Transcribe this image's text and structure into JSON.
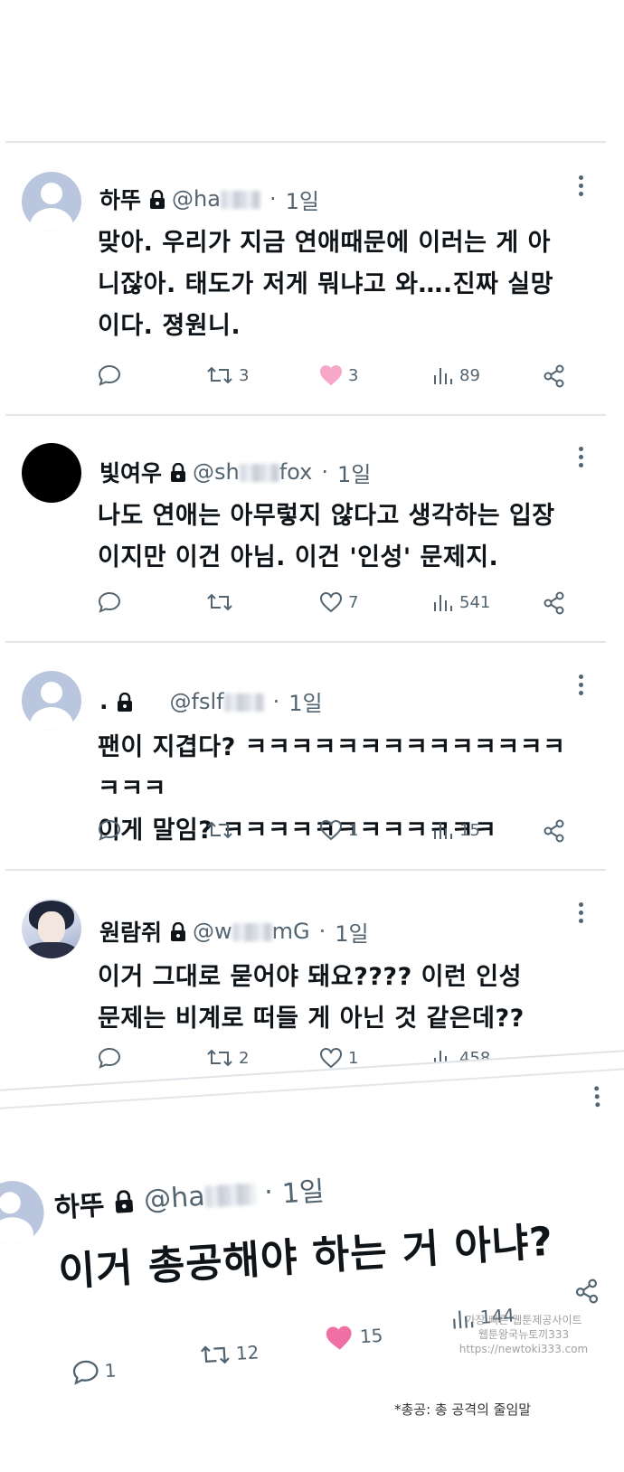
{
  "colors": {
    "like_active": "#f91880",
    "muted": "#536471",
    "divider": "#e4e6e8",
    "avatar_default": "#b9c6dd"
  },
  "tweets": [
    {
      "name": "하뚜",
      "locked": true,
      "handle_start": "@ha",
      "handle_end": "",
      "time": "1일",
      "lines": [
        "맞아. 우리가 지금 연애때문에 이러는 게 아",
        "니잖아. 태도가 저게 뭐냐고 와….진짜 실망",
        "이다. 졍원니."
      ],
      "replies": "",
      "retweets": "3",
      "likes": "3",
      "liked": true,
      "views": "89",
      "avatar": "default"
    },
    {
      "name": "빛여우",
      "locked": true,
      "handle_start": "@sh",
      "handle_end": "fox",
      "time": "1일",
      "lines": [
        "나도 연애는 아무렇지 않다고 생각하는 입장",
        "이지만 이건 아님. 이건 '인성' 문제지."
      ],
      "replies": "",
      "retweets": "",
      "likes": "7",
      "liked": false,
      "views": "541",
      "avatar": "black"
    },
    {
      "name": ".",
      "locked": true,
      "handle_start": "@fslf",
      "handle_end": "",
      "time": "1일",
      "lines": [
        "팬이 지겹다? ㅋㅋㅋㅋㅋㅋㅋㅋㅋㅋㅋㅋㅋㅋㅋㅋㅋ",
        "이게 말임? ㅋㅋㅋㅋㅋㅋㅋㅋㅋㅋㅋㅋ"
      ],
      "replies": "",
      "retweets": "",
      "likes": "1",
      "liked": false,
      "views": "15",
      "avatar": "default"
    },
    {
      "name": "원람쥐",
      "locked": true,
      "handle_start": "@w",
      "handle_end": "mG",
      "time": "1일",
      "lines": [
        "이거 그대로 묻어야 돼요???? 이런 인성",
        "문제는 비계로 떠들 게 아닌 것 같은데??"
      ],
      "replies": "",
      "retweets": "2",
      "likes": "1",
      "liked": false,
      "views": "458",
      "avatar": "photo"
    }
  ],
  "featured": {
    "name": "하뚜",
    "handle_start": "@ha",
    "time": "1일",
    "text": "이거 총공해야 하는 거 아냐?",
    "replies": "1",
    "retweets": "12",
    "likes": "15",
    "views": "144"
  },
  "footnote": "*총공: 총 공격의 줄임말",
  "watermark": [
    "가장 빠른 웹툰제공사이트",
    "웹툰왕국뉴토끼333",
    "https://newtoki333.com"
  ]
}
